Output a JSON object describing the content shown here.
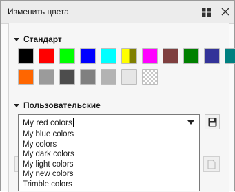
{
  "window": {
    "title": "Изменить цвета"
  },
  "icons": {
    "grid": "grid-icon",
    "close": "close-icon",
    "save": "floppy-disk-icon",
    "section_collapse": "triangle-down-icon",
    "dropdown_arrow": "chevron-down-icon"
  },
  "standard": {
    "label": "Стандарт",
    "swatches": [
      {
        "name": "black",
        "color": "#000000"
      },
      {
        "name": "red",
        "color": "#ff0000"
      },
      {
        "name": "green",
        "color": "#00ff00"
      },
      {
        "name": "blue",
        "color": "#0000ff"
      },
      {
        "name": "cyan",
        "color": "#00ffff"
      },
      {
        "name": "yellow-olive",
        "color": "#ffff00",
        "secondary": "#808000"
      },
      {
        "name": "magenta",
        "color": "#ff00ff"
      },
      {
        "name": "brown",
        "color": "#7f3f3f"
      },
      {
        "name": "dark-green",
        "color": "#008000"
      },
      {
        "name": "navy",
        "color": "#333399"
      },
      {
        "name": "teal",
        "color": "#008080"
      },
      {
        "name": "orange",
        "color": "#ff6600"
      },
      {
        "name": "gray-1",
        "color": "#9b9b9b"
      },
      {
        "name": "gray-2",
        "color": "#4d4d4d"
      },
      {
        "name": "gray-3",
        "color": "#808080"
      },
      {
        "name": "gray-4",
        "color": "#b3b3b3"
      },
      {
        "name": "gray-5",
        "color": "#e6e6e6"
      },
      {
        "name": "transparent",
        "color": "transparent"
      }
    ]
  },
  "custom": {
    "label": "Пользовательские",
    "selected": "My red colors",
    "options": [
      "My blue colors",
      "My colors",
      "My dark colors",
      "My light colors",
      "My new colors",
      "Trimble colors"
    ]
  }
}
